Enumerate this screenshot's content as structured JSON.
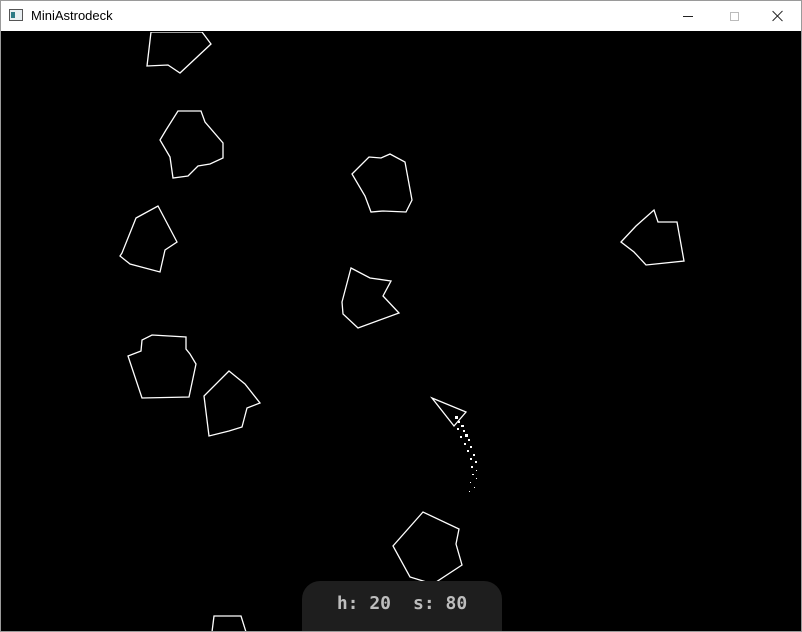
{
  "window": {
    "title": "MiniAstrodeck"
  },
  "icons": {
    "app": "app-window-icon",
    "minimize": "minimize-icon",
    "maximize": "maximize-icon",
    "close": "close-icon"
  },
  "colors": {
    "background": "#000000",
    "outline": "#ffffff",
    "hud_panel": "#1e1e1e",
    "hud_text": "#bdbdbd"
  },
  "hud": {
    "health_text": "h: 20",
    "score_text": "s: 80"
  },
  "game": {
    "health": 20,
    "score": 80
  }
}
